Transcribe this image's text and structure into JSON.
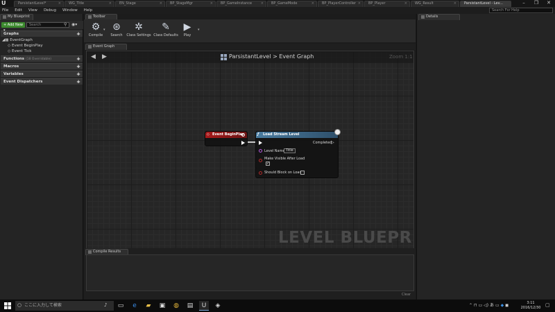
{
  "window": {
    "logo": "U",
    "tabs": [
      {
        "label": "ParsistantLevel*",
        "active": false
      },
      {
        "label": "WG_Title",
        "active": false
      },
      {
        "label": "EN_Stage",
        "active": false
      },
      {
        "label": "BP_StageMgr",
        "active": false
      },
      {
        "label": "BP_GameInstance",
        "active": false
      },
      {
        "label": "BP_GameMode",
        "active": false
      },
      {
        "label": "BP_PlayerController",
        "active": false
      },
      {
        "label": "BP_Player",
        "active": false
      },
      {
        "label": "WG_Result",
        "active": false
      },
      {
        "label": "ParsistantLevel - Lev...",
        "active": true
      }
    ],
    "controls": [
      "–",
      "❐",
      "✕"
    ]
  },
  "menu": [
    "File",
    "Edit",
    "View",
    "Debug",
    "Window",
    "Help"
  ],
  "help_search_placeholder": "Search For Help",
  "left_panel": {
    "tab": "My Blueprint",
    "add_new": "+ Add New ▾",
    "search_placeholder": "Search",
    "sections": {
      "graphs": "Graphs",
      "functions": "Functions",
      "functions_sub": "(18 Overridable)",
      "macros": "Macros",
      "variables": "Variables",
      "dispatchers": "Event Dispatchers"
    },
    "tree": {
      "event_graph": "EventGraph",
      "begin_play": "Event BeginPlay",
      "tick": "Event Tick"
    }
  },
  "toolbar": {
    "tab": "Toolbar",
    "compile": "Compile",
    "search": "Search",
    "class_settings": "Class Settings",
    "class_defaults": "Class Defaults",
    "play": "Play"
  },
  "graph": {
    "tab": "Event Graph",
    "breadcrumb_level": "ParsistantLevel",
    "breadcrumb_sep": ">",
    "breadcrumb_graph": "Event Graph",
    "zoom": "Zoom 1:1",
    "watermark": "LEVEL BLUEPRINT",
    "node_begin": {
      "title": "Event BeginPlay"
    },
    "node_load": {
      "title": "Load Stream Level",
      "completed": "Completed",
      "level_name_label": "Level Name",
      "level_name_value": "Title",
      "make_visible_label": "Make Visible After Load",
      "make_visible_checked": true,
      "should_block_label": "Should Block on Load",
      "should_block_checked": false
    }
  },
  "compile_results": {
    "tab": "Compile Results",
    "clear": "Clear"
  },
  "details": {
    "tab": "Details"
  },
  "taskbar": {
    "search_placeholder": "ここに入力して検索",
    "time": "3:11",
    "date": "2016/12/30"
  },
  "colors": {
    "begin_header": "#a8191a",
    "load_header": "#4a7ca0",
    "add_new": "#3c8a2e"
  }
}
